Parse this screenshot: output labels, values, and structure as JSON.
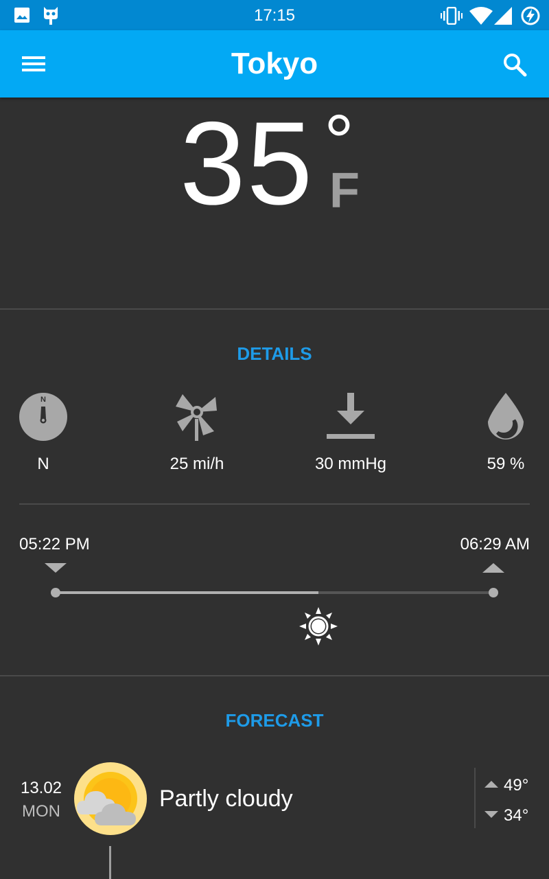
{
  "status_bar": {
    "time": "17:15",
    "left_icons": [
      "image-icon",
      "cyanogen-mascot-icon"
    ],
    "right_icons": [
      "vibrate-icon",
      "wifi-icon",
      "signal-icon",
      "battery-charging-icon"
    ]
  },
  "app_bar": {
    "title": "Tokyo",
    "menu_icon": "menu-icon",
    "search_icon": "search-icon",
    "color": "#03a9f4"
  },
  "current": {
    "temperature": "35",
    "degree_symbol": "°",
    "unit": "F"
  },
  "details": {
    "title": "DETAILS",
    "items": [
      {
        "icon": "compass-icon",
        "label": "N"
      },
      {
        "icon": "windmill-icon",
        "label": "25 mi/h"
      },
      {
        "icon": "pressure-icon",
        "label": "30 mmHg"
      },
      {
        "icon": "humidity-drop-icon",
        "label": "59 %"
      }
    ]
  },
  "sun": {
    "sunset": "05:22 PM",
    "sunrise": "06:29 AM",
    "progress": 0.6,
    "icon": "sun-icon"
  },
  "forecast": {
    "title": "FORECAST",
    "days": [
      {
        "date": "13.02",
        "day": "MON",
        "icon": "partly-cloudy-icon",
        "condition": "Partly cloudy",
        "high": "49°",
        "low": "34°"
      }
    ]
  },
  "colors": {
    "background": "#303030",
    "accent": "#1e9be8",
    "status_bar": "#0288d1"
  }
}
